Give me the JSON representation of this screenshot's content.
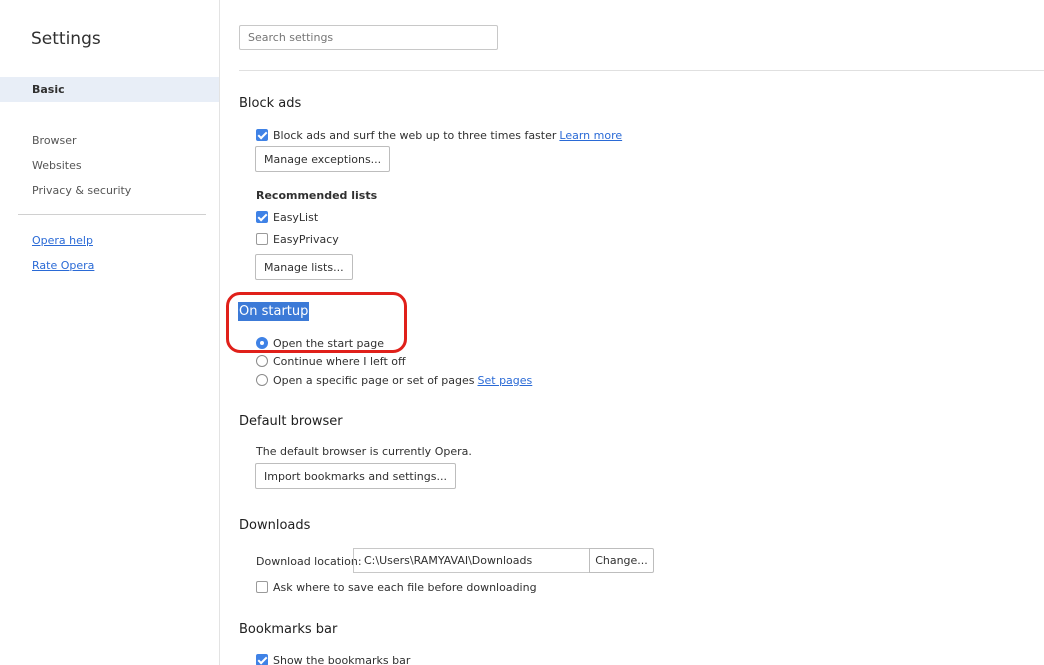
{
  "sidebar": {
    "title": "Settings",
    "basic_label": "Basic",
    "items": [
      "Browser",
      "Websites",
      "Privacy & security"
    ],
    "links": [
      "Opera help",
      "Rate Opera"
    ]
  },
  "search": {
    "placeholder": "Search settings"
  },
  "block_ads": {
    "title": "Block ads",
    "checkbox_label": "Block ads and surf the web up to three times faster",
    "checkbox_checked": true,
    "learn_more": "Learn more",
    "manage_exceptions": "Manage exceptions...",
    "recommended_title": "Recommended lists",
    "lists": [
      {
        "label": "EasyList",
        "checked": true
      },
      {
        "label": "EasyPrivacy",
        "checked": false
      }
    ],
    "manage_lists": "Manage lists..."
  },
  "startup": {
    "title": "On startup",
    "options": [
      {
        "label": "Open the start page",
        "selected": true
      },
      {
        "label": "Continue where I left off",
        "selected": false
      },
      {
        "label": "Open a specific page or set of pages",
        "selected": false
      }
    ],
    "set_pages": "Set pages"
  },
  "default_browser": {
    "title": "Default browser",
    "status": "The default browser is currently Opera.",
    "import_button": "Import bookmarks and settings..."
  },
  "downloads": {
    "title": "Downloads",
    "location_label": "Download location:",
    "location_value": "C:\\Users\\RAMYAVAI\\Downloads",
    "change_button": "Change...",
    "ask_label": "Ask where to save each file before downloading",
    "ask_checked": false
  },
  "bookmarks_bar": {
    "title": "Bookmarks bar",
    "show_label": "Show the bookmarks bar",
    "show_checked": true
  },
  "colors": {
    "accent": "#3f82e6",
    "link": "#2a6ad6",
    "annotation": "#e0201a"
  }
}
